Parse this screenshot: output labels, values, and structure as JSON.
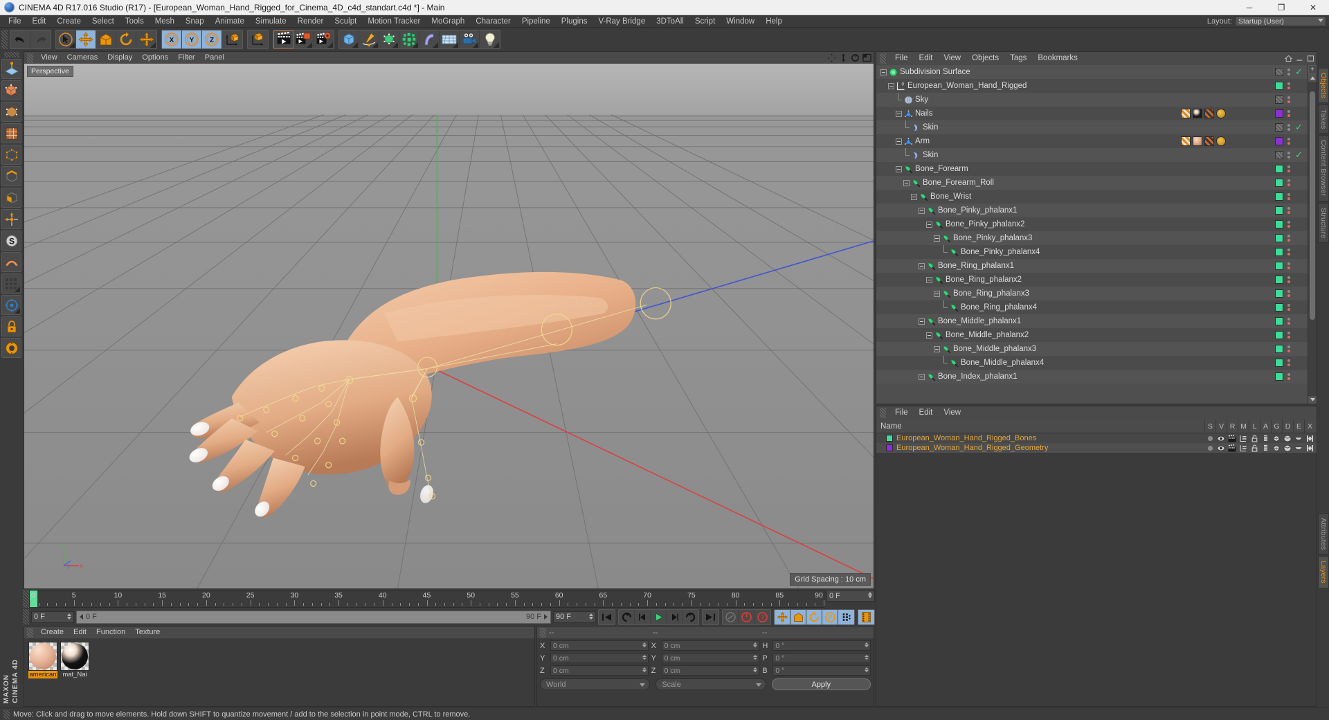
{
  "window": {
    "title": "CINEMA 4D R17.016 Studio (R17) - [European_Woman_Hand_Rigged_for_Cinema_4D_c4d_standart.c4d *] - Main",
    "minimize": "─",
    "maximize": "❐",
    "close": "✕"
  },
  "menubar": {
    "items": [
      "File",
      "Edit",
      "Create",
      "Select",
      "Tools",
      "Mesh",
      "Snap",
      "Animate",
      "Simulate",
      "Render",
      "Sculpt",
      "Motion Tracker",
      "MoGraph",
      "Character",
      "Pipeline",
      "Plugins",
      "V-Ray Bridge",
      "3DToAll",
      "Script",
      "Window",
      "Help"
    ],
    "layout_label": "Layout:",
    "layout_value": "Startup (User)"
  },
  "viewport": {
    "menus": [
      "View",
      "Cameras",
      "Display",
      "Options",
      "Filter",
      "Panel"
    ],
    "label": "Perspective",
    "grid_spacing": "Grid Spacing : 10 cm",
    "axis": {
      "x": "X",
      "y": "Y",
      "z": "Z"
    }
  },
  "timeline": {
    "ticks": [
      {
        "label": "0",
        "frame": 0
      },
      {
        "label": "5",
        "frame": 5
      },
      {
        "label": "10",
        "frame": 10
      },
      {
        "label": "15",
        "frame": 15
      },
      {
        "label": "20",
        "frame": 20
      },
      {
        "label": "25",
        "frame": 25
      },
      {
        "label": "30",
        "frame": 30
      },
      {
        "label": "35",
        "frame": 35
      },
      {
        "label": "40",
        "frame": 40
      },
      {
        "label": "45",
        "frame": 45
      },
      {
        "label": "50",
        "frame": 50
      },
      {
        "label": "55",
        "frame": 55
      },
      {
        "label": "60",
        "frame": 60
      },
      {
        "label": "65",
        "frame": 65
      },
      {
        "label": "70",
        "frame": 70
      },
      {
        "label": "75",
        "frame": 75
      },
      {
        "label": "80",
        "frame": 80
      },
      {
        "label": "85",
        "frame": 85
      },
      {
        "label": "90",
        "frame": 90
      }
    ],
    "current_frame_top": "0 F",
    "current_frame_left": "0 F",
    "slider_start": "0 F",
    "slider_end": "90 F",
    "range_end": "90 F",
    "playhead_frame": 0,
    "max_frame": 90
  },
  "materials": {
    "menus": [
      "Create",
      "Edit",
      "Function",
      "Texture"
    ],
    "items": [
      {
        "name": "american",
        "selected": true,
        "color": "#e8b59a"
      },
      {
        "name": "mat_Nai",
        "selected": false,
        "color": "#f0d9c6"
      }
    ]
  },
  "coordinates": {
    "headers": [
      "--",
      "--",
      "--"
    ],
    "position": {
      "x_label": "X",
      "y_label": "Y",
      "z_label": "Z",
      "x": "0 cm",
      "y": "0 cm",
      "z": "0 cm"
    },
    "size": {
      "x_label": "X",
      "y_label": "Y",
      "z_label": "Z",
      "x": "0 cm",
      "y": "0 cm",
      "z": "0 cm"
    },
    "rotation": {
      "h_label": "H",
      "p_label": "P",
      "b_label": "B",
      "h": "0 °",
      "p": "0 °",
      "b": "0 °"
    },
    "system": "World",
    "mode": "Scale",
    "apply": "Apply"
  },
  "object_manager": {
    "menus": [
      "File",
      "Edit",
      "View",
      "Objects",
      "Tags",
      "Bookmarks"
    ],
    "rows": [
      {
        "name": "Subdivision Surface",
        "depth": 0,
        "icon": "subdivision-surface-icon",
        "expander": "plus",
        "cbox": "hatch",
        "check": true,
        "dots": false,
        "tags": []
      },
      {
        "name": "European_Woman_Hand_Rigged",
        "depth": 1,
        "icon": "null-object-icon",
        "expander": "plus",
        "cbox": "green",
        "check": false,
        "dots": true,
        "tags": []
      },
      {
        "name": "Sky",
        "depth": 2,
        "icon": "sky-icon",
        "expander": "elbow",
        "cbox": "hatch",
        "check": false,
        "dots": true,
        "tags": []
      },
      {
        "name": "Nails",
        "depth": 2,
        "icon": "polygon-object-icon",
        "expander": "plus",
        "cbox": "purple",
        "check": false,
        "dots": true,
        "tags": [
          "uvw-tag",
          "texture-tag-nails",
          "phong-tag",
          "weight-tag"
        ]
      },
      {
        "name": "Skin",
        "depth": 3,
        "icon": "skin-deformer-icon",
        "expander": "elbow",
        "cbox": "hatch",
        "check": true,
        "dots": false,
        "tags": []
      },
      {
        "name": "Arm",
        "depth": 2,
        "icon": "polygon-object-icon",
        "expander": "plus",
        "cbox": "purple",
        "check": false,
        "dots": true,
        "tags": [
          "uvw-tag",
          "texture-tag-skin",
          "phong-tag",
          "weight-tag"
        ]
      },
      {
        "name": "Skin",
        "depth": 3,
        "icon": "skin-deformer-icon",
        "expander": "elbow",
        "cbox": "hatch",
        "check": true,
        "dots": false,
        "tags": []
      },
      {
        "name": "Bone_Forearm",
        "depth": 2,
        "icon": "joint-icon",
        "expander": "plus",
        "cbox": "green",
        "check": false,
        "dots": true,
        "tags": []
      },
      {
        "name": "Bone_Forearm_Roll",
        "depth": 3,
        "icon": "joint-icon",
        "expander": "plus",
        "cbox": "green",
        "check": false,
        "dots": true,
        "tags": []
      },
      {
        "name": "Bone_Wrist",
        "depth": 4,
        "icon": "joint-icon",
        "expander": "plus",
        "cbox": "green",
        "check": false,
        "dots": true,
        "tags": []
      },
      {
        "name": "Bone_Pinky_phalanx1",
        "depth": 5,
        "icon": "joint-icon",
        "expander": "plus",
        "cbox": "green",
        "check": false,
        "dots": true,
        "tags": []
      },
      {
        "name": "Bone_Pinky_phalanx2",
        "depth": 6,
        "icon": "joint-icon",
        "expander": "plus",
        "cbox": "green",
        "check": false,
        "dots": true,
        "tags": []
      },
      {
        "name": "Bone_Pinky_phalanx3",
        "depth": 7,
        "icon": "joint-icon",
        "expander": "plus",
        "cbox": "green",
        "check": false,
        "dots": true,
        "tags": []
      },
      {
        "name": "Bone_Pinky_phalanx4",
        "depth": 8,
        "icon": "joint-icon",
        "expander": "elbow",
        "cbox": "green",
        "check": false,
        "dots": true,
        "tags": []
      },
      {
        "name": "Bone_Ring_phalanx1",
        "depth": 5,
        "icon": "joint-icon",
        "expander": "plus",
        "cbox": "green",
        "check": false,
        "dots": true,
        "tags": []
      },
      {
        "name": "Bone_Ring_phalanx2",
        "depth": 6,
        "icon": "joint-icon",
        "expander": "plus",
        "cbox": "green",
        "check": false,
        "dots": true,
        "tags": []
      },
      {
        "name": "Bone_Ring_phalanx3",
        "depth": 7,
        "icon": "joint-icon",
        "expander": "plus",
        "cbox": "green",
        "check": false,
        "dots": true,
        "tags": []
      },
      {
        "name": "Bone_Ring_phalanx4",
        "depth": 8,
        "icon": "joint-icon",
        "expander": "elbow",
        "cbox": "green",
        "check": false,
        "dots": true,
        "tags": []
      },
      {
        "name": "Bone_Middle_phalanx1",
        "depth": 5,
        "icon": "joint-icon",
        "expander": "plus",
        "cbox": "green",
        "check": false,
        "dots": true,
        "tags": []
      },
      {
        "name": "Bone_Middle_phalanx2",
        "depth": 6,
        "icon": "joint-icon",
        "expander": "plus",
        "cbox": "green",
        "check": false,
        "dots": true,
        "tags": []
      },
      {
        "name": "Bone_Middle_phalanx3",
        "depth": 7,
        "icon": "joint-icon",
        "expander": "plus",
        "cbox": "green",
        "check": false,
        "dots": true,
        "tags": []
      },
      {
        "name": "Bone_Middle_phalanx4",
        "depth": 8,
        "icon": "joint-icon",
        "expander": "elbow",
        "cbox": "green",
        "check": false,
        "dots": true,
        "tags": []
      },
      {
        "name": "Bone_Index_phalanx1",
        "depth": 5,
        "icon": "joint-icon",
        "expander": "plus",
        "cbox": "green",
        "check": false,
        "dots": true,
        "tags": []
      }
    ]
  },
  "layer_manager": {
    "menus": [
      "File",
      "Edit",
      "View"
    ],
    "name_header": "Name",
    "columns": [
      "S",
      "V",
      "R",
      "M",
      "L",
      "A",
      "G",
      "D",
      "E",
      "X"
    ],
    "rows": [
      {
        "name": "European_Woman_Hand_Rigged_Bones",
        "color": "#3ddc9a"
      },
      {
        "name": "European_Woman_Hand_Rigged_Geometry",
        "color": "#8b2fd6"
      }
    ]
  },
  "right_tabs": {
    "top": [
      {
        "label": "Objects",
        "active": true
      },
      {
        "label": "Takes",
        "active": false
      },
      {
        "label": "Content Browser",
        "active": false
      },
      {
        "label": "Structure",
        "active": false
      }
    ],
    "bottom": [
      {
        "label": "Attributes",
        "active": false
      },
      {
        "label": "Layers",
        "active": true
      }
    ]
  },
  "statusbar": {
    "text": "Move: Click and drag to move elements. Hold down SHIFT to quantize movement / add to the selection in point mode, CTRL to remove."
  },
  "toolbar": {
    "groups": [
      {
        "name": "undo-redo",
        "buttons": [
          {
            "icon": "undo-icon",
            "active": false
          },
          {
            "icon": "redo-icon",
            "active": false,
            "disabled": true
          }
        ]
      },
      {
        "name": "transform",
        "buttons": [
          {
            "icon": "live-selection-icon",
            "active": false,
            "corner": true
          },
          {
            "icon": "move-icon",
            "active": true
          },
          {
            "icon": "scale-icon",
            "active": false
          },
          {
            "icon": "rotate-icon",
            "active": false
          },
          {
            "icon": "move-alt-icon",
            "active": false,
            "corner": true
          }
        ]
      },
      {
        "name": "axis-lock",
        "buttons": [
          {
            "icon": "x-axis-icon",
            "active": true
          },
          {
            "icon": "y-axis-icon",
            "active": true
          },
          {
            "icon": "z-axis-icon",
            "active": true
          },
          {
            "icon": "world-axis-icon",
            "active": false
          }
        ]
      },
      {
        "name": "coord-sys",
        "buttons": [
          {
            "icon": "object-axis-icon",
            "active": false
          }
        ]
      },
      {
        "name": "render",
        "buttons": [
          {
            "icon": "render-view-icon",
            "active": false,
            "selected": true
          },
          {
            "icon": "render-picture-viewer-icon",
            "active": false,
            "corner": true
          },
          {
            "icon": "render-settings-icon",
            "active": false,
            "corner": true
          }
        ]
      },
      {
        "name": "primitives",
        "buttons": [
          {
            "icon": "cube-icon",
            "active": false,
            "corner": true
          },
          {
            "icon": "spline-pen-icon",
            "active": false,
            "corner": true
          },
          {
            "icon": "nurbs-icon",
            "active": false,
            "corner": true
          },
          {
            "icon": "array-icon",
            "active": false,
            "corner": true
          },
          {
            "icon": "bend-deformer-icon",
            "active": false,
            "corner": true
          },
          {
            "icon": "floor-icon",
            "active": false,
            "corner": true
          },
          {
            "icon": "camera-icon",
            "active": false,
            "corner": true
          },
          {
            "icon": "light-icon",
            "active": false,
            "corner": true
          }
        ]
      }
    ]
  },
  "left_toolbar": {
    "buttons": [
      {
        "icon": "workplane-icon",
        "corner": false
      },
      {
        "icon": "make-editable-icon",
        "corner": false
      },
      {
        "icon": "model-mode-icon",
        "corner": false
      },
      {
        "icon": "texture-mode-icon",
        "corner": false
      },
      {
        "icon": "point-mode-icon",
        "corner": false
      },
      {
        "icon": "edge-mode-icon",
        "corner": false
      },
      {
        "icon": "polygon-mode-icon",
        "corner": false
      },
      {
        "icon": "axis-mode-icon",
        "corner": false
      },
      {
        "icon": "enable-axis-icon",
        "corner": false
      },
      {
        "icon": "subdivide-icon",
        "corner": false
      },
      {
        "icon": "magnet-icon",
        "corner": true
      },
      {
        "icon": "snap-icon",
        "corner": true
      },
      {
        "icon": "lock-icon",
        "corner": false
      },
      {
        "icon": "viewport-solo-icon",
        "corner": false
      }
    ],
    "brand_line1": "MAXON",
    "brand_line2": "CINEMA 4D"
  },
  "playback": {
    "controls": [
      {
        "icon": "goto-start-icon"
      },
      {
        "icon": "step-back-keyframe-icon"
      },
      {
        "icon": "step-back-frame-icon"
      },
      {
        "icon": "play-icon"
      },
      {
        "icon": "step-forward-frame-icon"
      },
      {
        "icon": "step-forward-keyframe-icon"
      },
      {
        "icon": "goto-end-icon"
      }
    ],
    "record_group": [
      {
        "icon": "record-active-objects-icon"
      },
      {
        "icon": "autokey-icon"
      },
      {
        "icon": "keyframe-selection-icon"
      }
    ],
    "pos_group": [
      {
        "icon": "record-position-icon",
        "active": true
      },
      {
        "icon": "record-scale-icon",
        "active": true
      },
      {
        "icon": "record-rotation-icon",
        "active": true
      },
      {
        "icon": "record-param-icon",
        "active": true
      },
      {
        "icon": "record-pla-icon",
        "active": true
      }
    ],
    "timeline_button": {
      "icon": "timeline-icon",
      "active": true
    }
  }
}
